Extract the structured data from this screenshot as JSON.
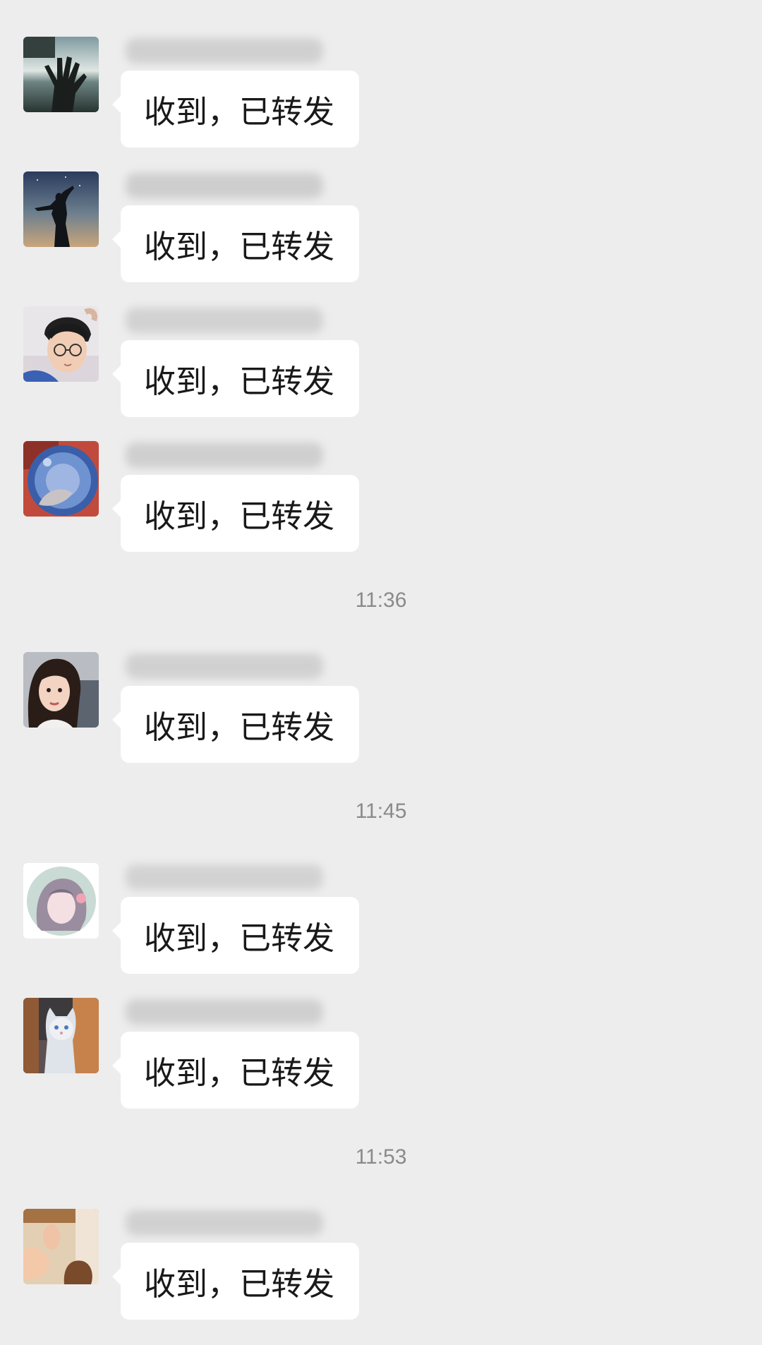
{
  "colors": {
    "background": "#ededed",
    "bubble": "#ffffff",
    "text": "#191919",
    "timestamp": "#8a8a8a"
  },
  "messages_group_1": [
    {
      "text": "收到，已转发",
      "avatar": "hand-silhouette-avatar"
    },
    {
      "text": "收到，已转发",
      "avatar": "dancing-silhouette-avatar"
    },
    {
      "text": "收到，已转发",
      "avatar": "man-with-glasses-avatar"
    },
    {
      "text": "收到，已转发",
      "avatar": "blue-globe-avatar"
    }
  ],
  "timestamps": [
    "11:36",
    "11:45",
    "11:53"
  ],
  "messages_group_2": [
    {
      "text": "收到，已转发",
      "avatar": "woman-portrait-avatar"
    }
  ],
  "messages_group_3": [
    {
      "text": "收到，已转发",
      "avatar": "anime-girl-circle-avatar"
    },
    {
      "text": "收到，已转发",
      "avatar": "ragdoll-cat-avatar"
    }
  ],
  "messages_group_4": [
    {
      "text": "收到，已转发",
      "avatar": "baby-feet-avatar"
    }
  ]
}
